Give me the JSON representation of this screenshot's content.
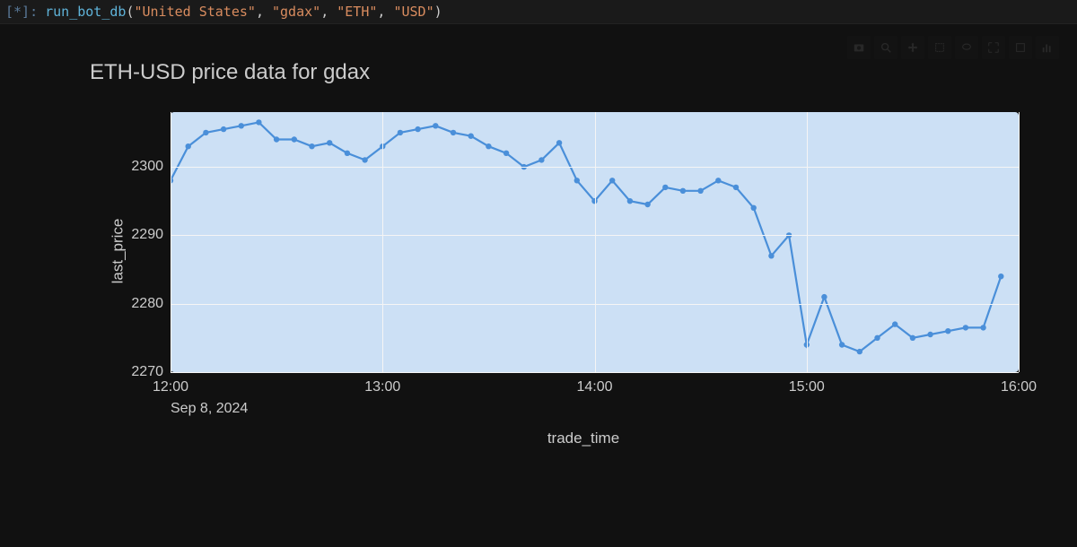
{
  "cell": {
    "prompt": "[*]:",
    "fn": "run_bot_db",
    "args": [
      "\"United States\"",
      "\"gdax\"",
      "\"ETH\"",
      "\"USD\""
    ]
  },
  "toolbar": {
    "items": [
      "camera-icon",
      "zoom-icon",
      "pan-icon",
      "zoom-in-icon",
      "zoom-out-icon",
      "autoscale-icon",
      "reset-icon",
      "logo-icon"
    ]
  },
  "chart_data": {
    "type": "line",
    "title": "ETH-USD price data for gdax",
    "xlabel": "trade_time",
    "ylabel": "last_price",
    "x_date": "Sep 8, 2024",
    "ylim": [
      2270,
      2308
    ],
    "y_ticks": [
      2270,
      2280,
      2290,
      2300
    ],
    "x_ticks": [
      "12:00",
      "13:00",
      "14:00",
      "15:00",
      "16:00"
    ],
    "x": [
      "12:00",
      "12:05",
      "12:10",
      "12:15",
      "12:20",
      "12:25",
      "12:30",
      "12:35",
      "12:40",
      "12:45",
      "12:50",
      "12:55",
      "13:00",
      "13:05",
      "13:10",
      "13:15",
      "13:20",
      "13:25",
      "13:30",
      "13:35",
      "13:40",
      "13:45",
      "13:50",
      "13:55",
      "14:00",
      "14:05",
      "14:10",
      "14:15",
      "14:20",
      "14:25",
      "14:30",
      "14:35",
      "14:40",
      "14:45",
      "14:50",
      "14:55",
      "15:00",
      "15:05",
      "15:10",
      "15:15",
      "15:20",
      "15:25",
      "15:30",
      "15:35",
      "15:40",
      "15:45",
      "15:50"
    ],
    "y": [
      2298,
      2303,
      2305,
      2305.5,
      2306,
      2306.5,
      2304,
      2304,
      2303,
      2303.5,
      2302,
      2301,
      2303,
      2305,
      2305.5,
      2306,
      2305,
      2304.5,
      2303,
      2302,
      2300,
      2301,
      2303.5,
      2298,
      2295,
      2298,
      2295,
      2294.5,
      2297,
      2296.5,
      2296.5,
      2298,
      2297,
      2294,
      2287,
      2290,
      2274,
      2281,
      2274,
      2273,
      2275,
      2277,
      2275,
      2275.5,
      2276,
      2276.5,
      2276.5
    ],
    "last_x": "15:55",
    "last_y": 2284
  }
}
